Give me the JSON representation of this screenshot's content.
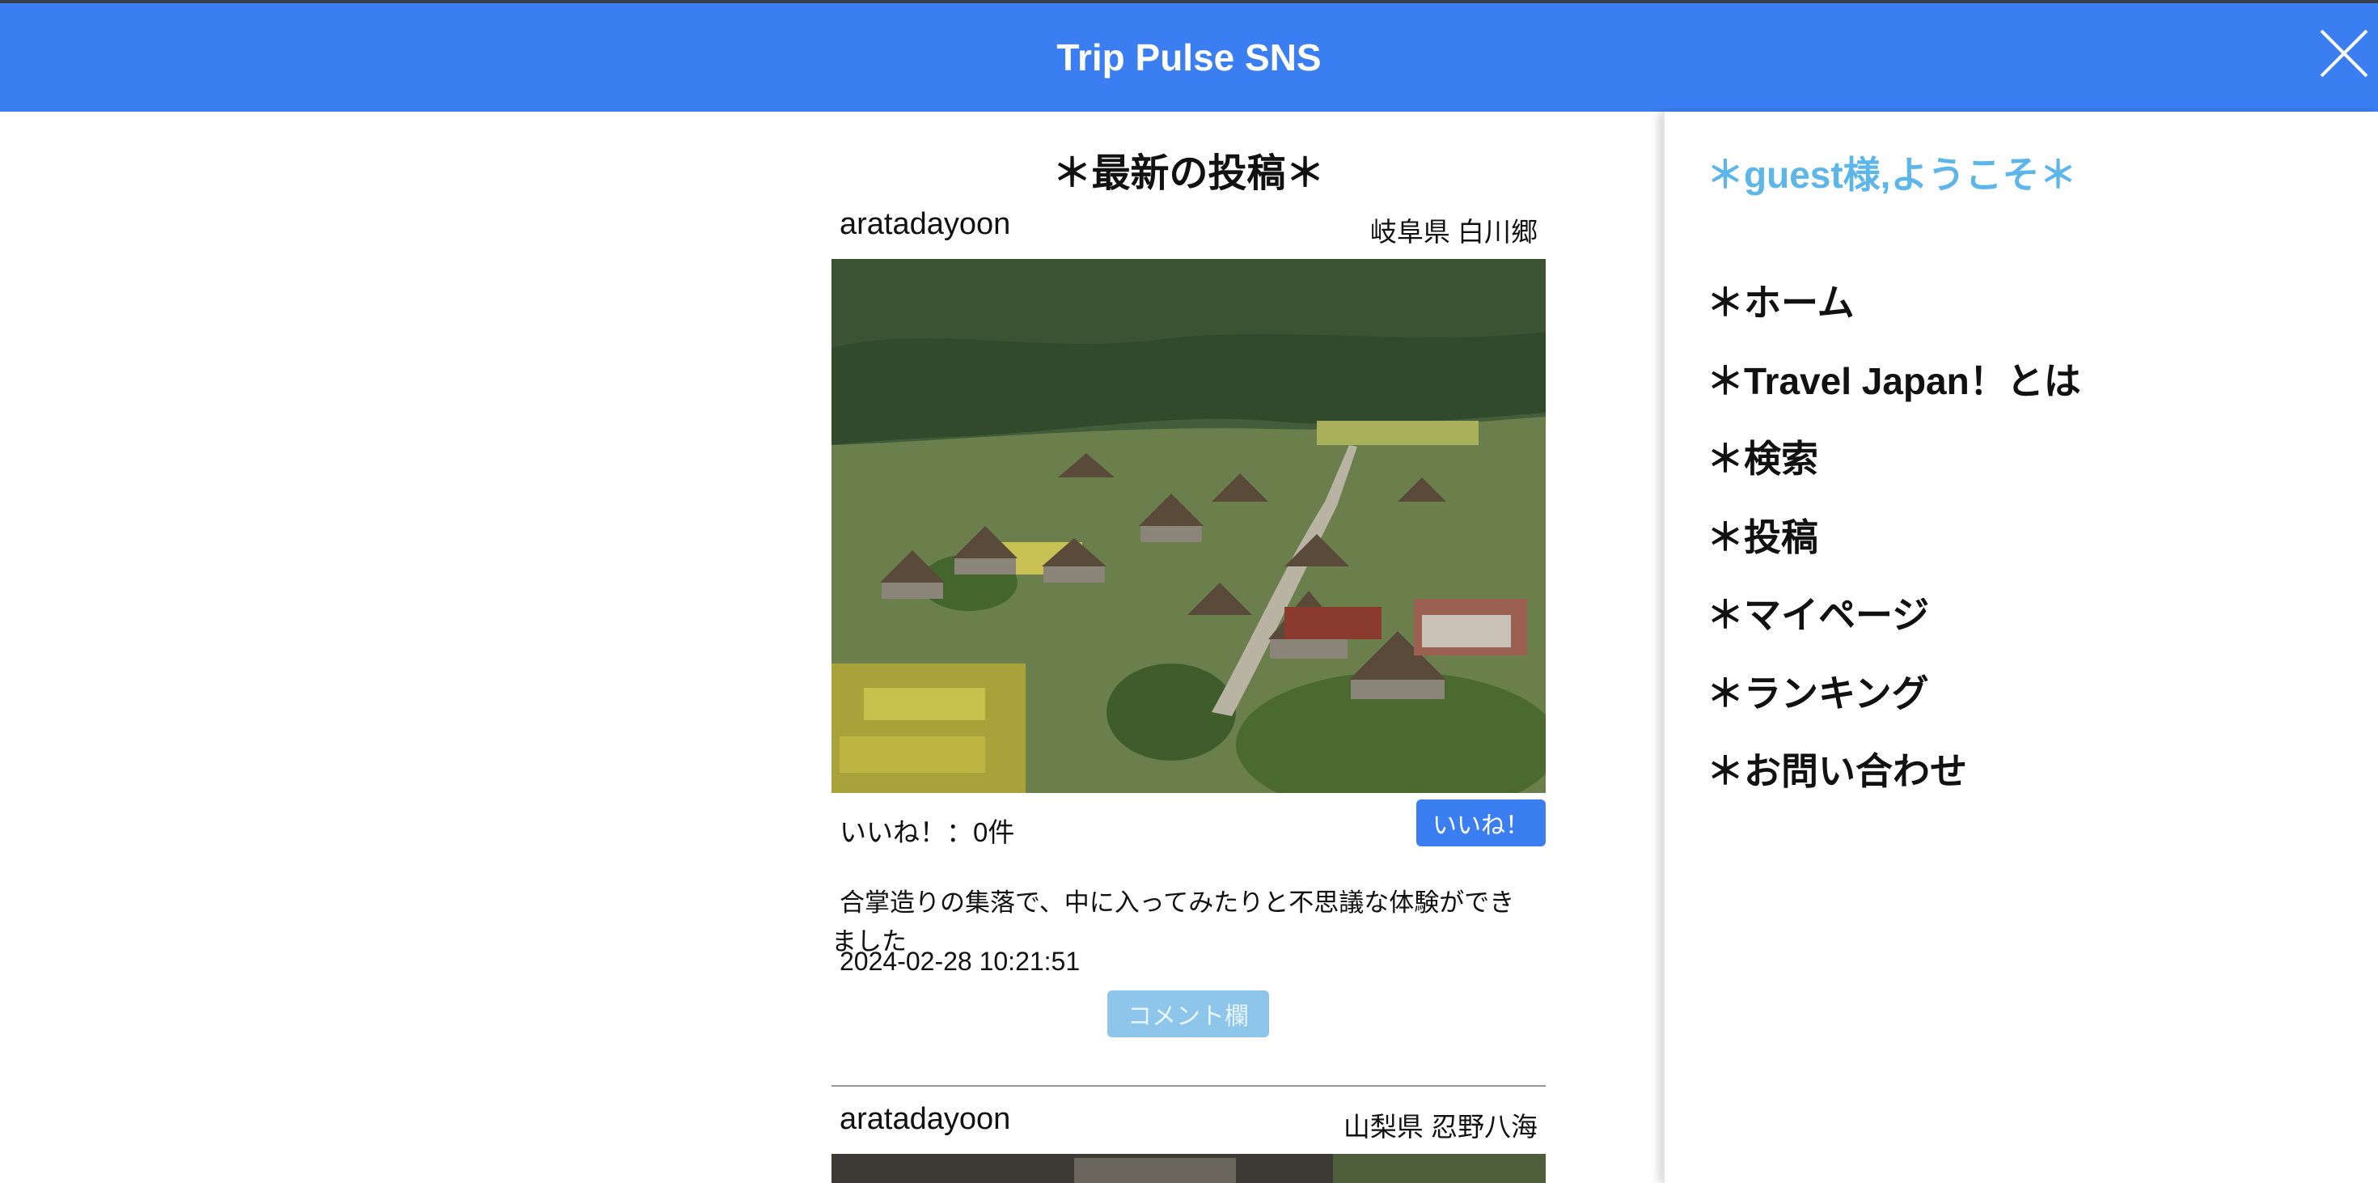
{
  "header": {
    "title": "Trip Pulse SNS",
    "close_icon": "close-icon"
  },
  "feed": {
    "heading": "＊最新の投稿＊",
    "posts": [
      {
        "user": "aratadayoon",
        "location": "岐阜県 白川郷",
        "image": "village-photo",
        "likes": "いいね！：0件",
        "like_label": "いいね！",
        "text": "合掌造りの集落で、中に入ってみたりと不思議な体験ができました",
        "date": "2024-02-28 10:21:51",
        "comment_label": "コメント欄"
      },
      {
        "user": "aratadayoon",
        "location": "山梨県 忍野八海",
        "image": "partial-photo"
      }
    ]
  },
  "side": {
    "welcome": "＊guest様,ようこそ＊",
    "menu": [
      "＊ホーム",
      "＊Travel Japan！とは",
      "＊検索",
      "＊投稿",
      "＊マイページ",
      "＊ランキング",
      "＊お問い合わせ"
    ]
  },
  "colors": {
    "header": "#3b7ef2",
    "welcome": "#5cb6ea",
    "comment_button": "#8ec5ea"
  }
}
